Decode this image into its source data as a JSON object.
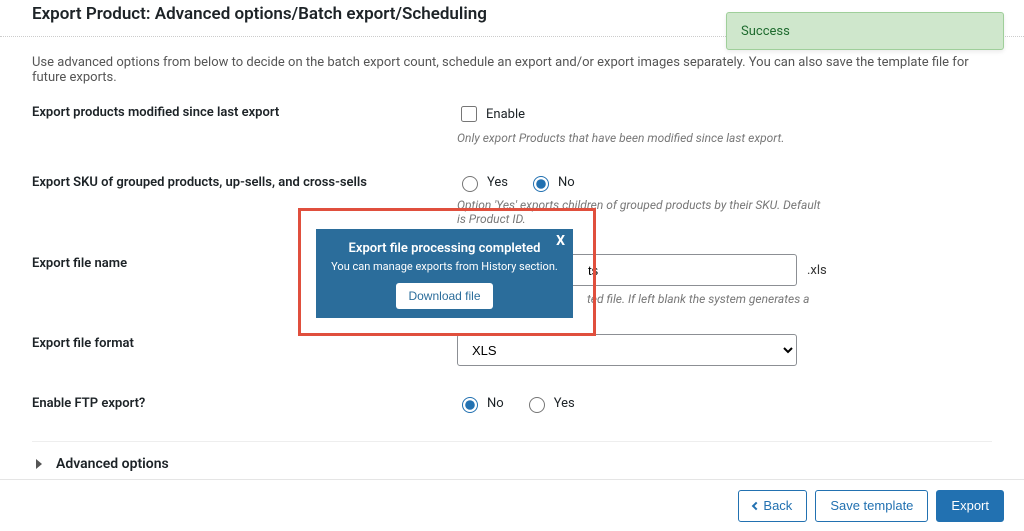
{
  "heading": "Export Product: Advanced options/Batch export/Scheduling",
  "intro": "Use advanced options from below to decide on the batch export count, schedule an export and/or export images separately. You can also save the template file for future exports.",
  "fields": {
    "modified": {
      "label": "Export products modified since last export",
      "checkbox_label": "Enable",
      "help": "Only export Products that have been modified since last export."
    },
    "sku": {
      "label": "Export SKU of grouped products, up-sells, and cross-sells",
      "opt_yes": "Yes",
      "opt_no": "No",
      "help": "Option 'Yes' exports children of grouped products by their SKU. Default is Product ID."
    },
    "filename": {
      "label": "Export file name",
      "value_visible": "ts",
      "ext": ".xls",
      "help_visible": "ted file. If left blank the system generates a"
    },
    "format": {
      "label": "Export file format",
      "value": "XLS"
    },
    "ftp": {
      "label": "Enable FTP export?",
      "opt_no": "No",
      "opt_yes": "Yes"
    }
  },
  "accordion": {
    "title": "Advanced options"
  },
  "modal": {
    "title": "Export file processing completed",
    "subtitle": "You can manage exports from History section.",
    "button": "Download file",
    "close": "X"
  },
  "toast": {
    "text": "Success"
  },
  "footer": {
    "back": "Back",
    "save": "Save template",
    "export": "Export"
  }
}
